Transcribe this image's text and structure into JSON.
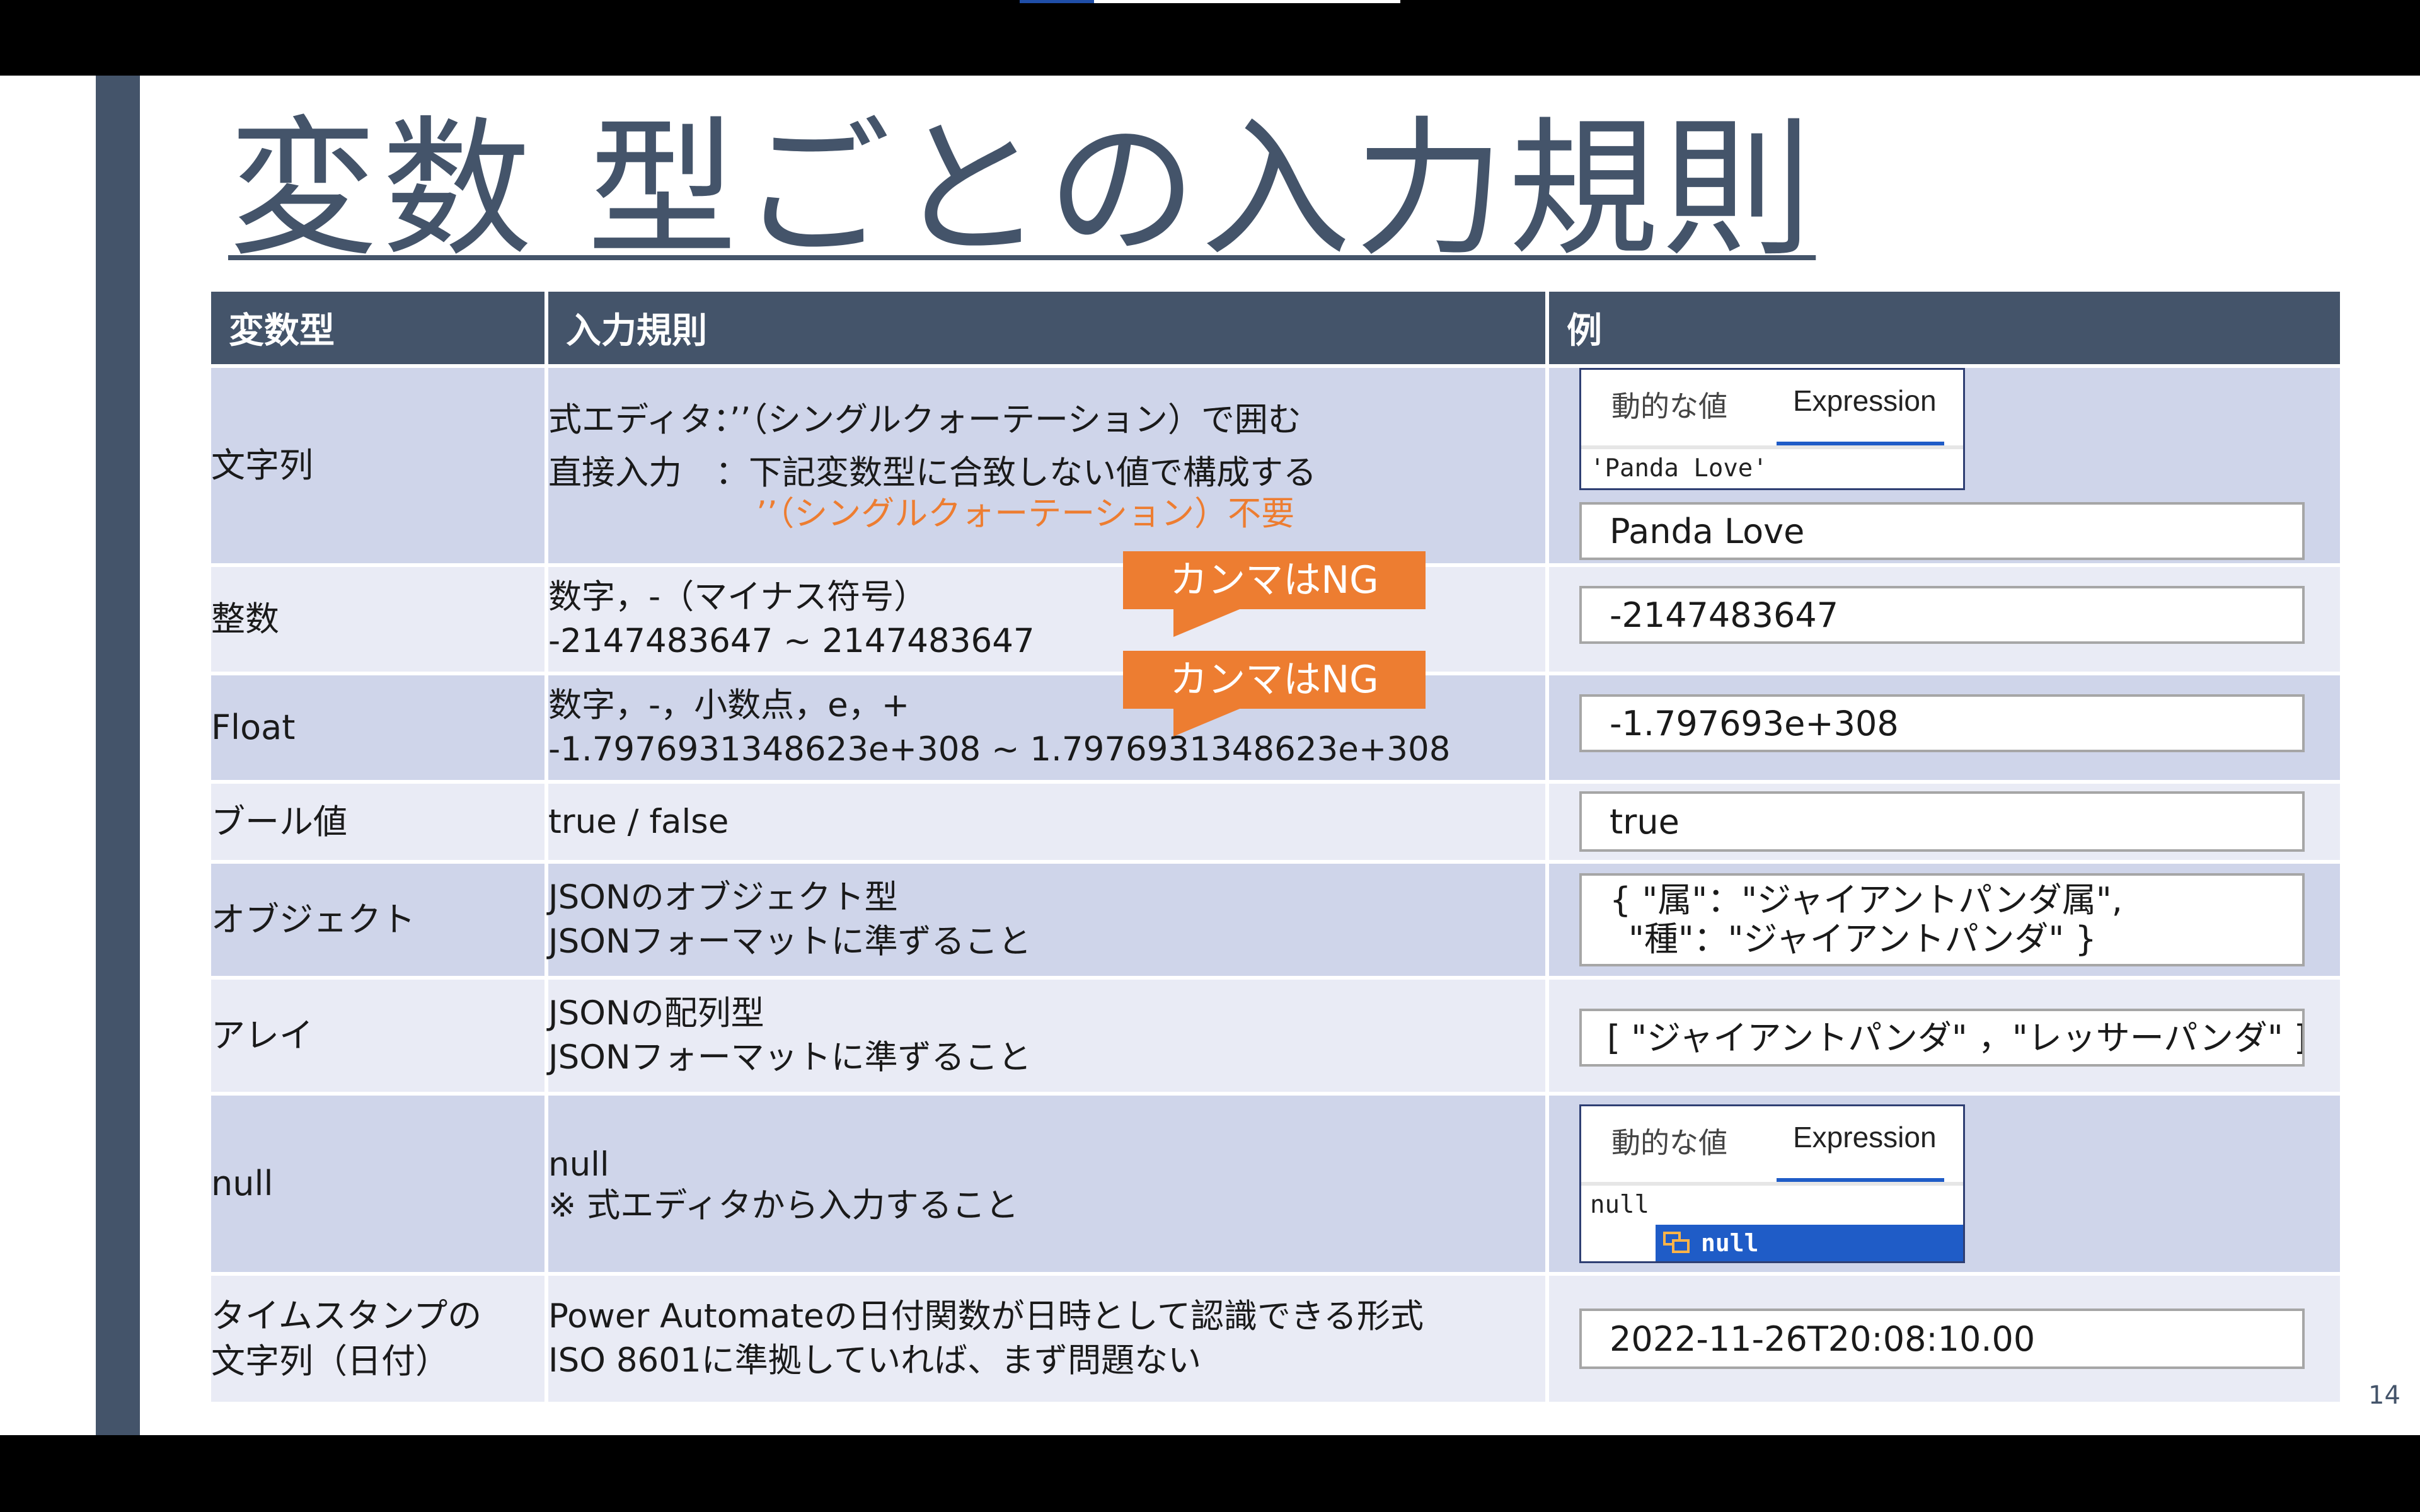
{
  "slide": {
    "title": "変数 型ごとの入力規則",
    "page_number": "14"
  },
  "table": {
    "headers": [
      "変数型",
      "入力規則",
      "例"
    ],
    "rows": [
      {
        "type": "文字列",
        "rule_lines": [
          "式エディタ：’’（シングルクォーテーション）で囲む",
          "直接入力　：下記変数型に合致しない値で構成する"
        ],
        "rule_note": "’’（シングルクォーテーション）不要",
        "example": {
          "tabs": [
            "動的な値",
            "Expression"
          ],
          "code": "'Panda Love'",
          "value": "Panda Love"
        }
      },
      {
        "type": "整数",
        "rule_lines": [
          "数字，-（マイナス符号）",
          "-2147483647 ~ 2147483647"
        ],
        "example": {
          "value": "-2147483647"
        }
      },
      {
        "type": "Float",
        "rule_lines": [
          "数字，-，小数点，e，+",
          "-1.7976931348623e+308 ~ 1.7976931348623e+308"
        ],
        "example": {
          "value": "-1.797693e+308"
        }
      },
      {
        "type": "ブール値",
        "rule_lines": [
          "true / false"
        ],
        "example": {
          "value": "true"
        }
      },
      {
        "type": "オブジェクト",
        "rule_lines": [
          "JSONのオブジェクト型",
          "JSONフォーマットに準ずること"
        ],
        "example": {
          "value_lines": [
            "{ \"属\"：\"ジャイアントパンダ属\",",
            "\"種\"：\"ジャイアントパンダ\" }"
          ]
        }
      },
      {
        "type": "アレイ",
        "rule_lines": [
          "JSONの配列型",
          "JSONフォーマットに準ずること"
        ],
        "example": {
          "value": "[ \"ジャイアントパンダ\" ，\"レッサーパンダ\" ]"
        }
      },
      {
        "type": "null",
        "rule_lines": [
          "null",
          "※ 式エディタから入力すること"
        ],
        "example": {
          "tabs": [
            "動的な値",
            "Expression"
          ],
          "code": "null",
          "suggestion": "null"
        }
      },
      {
        "type_lines": [
          "タイムスタンプの",
          "文字列（日付）"
        ],
        "rule_lines": [
          "Power Automateの日付関数が日時として認識できる形式",
          "ISO 8601に準拠していれば、まず問題ない"
        ],
        "example": {
          "value": "2022-11-26T20:08:10.00"
        }
      }
    ]
  },
  "callouts": [
    "カンマはNG",
    "カンマはNG"
  ],
  "colors": {
    "header_bg": "#44546a",
    "row_dark": "#cfd5ea",
    "row_light": "#e9ebf5",
    "accent_orange": "#ed7d31",
    "selection_blue": "#1f5cc7"
  }
}
